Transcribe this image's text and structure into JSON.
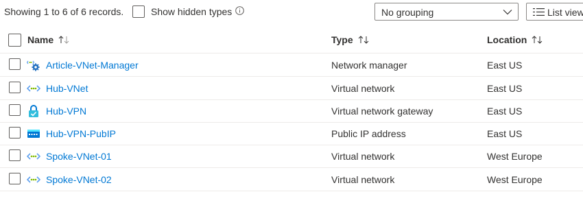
{
  "toolbar": {
    "records_text": "Showing 1 to 6 of 6 records.",
    "show_hidden_label": "Show hidden types",
    "grouping_value": "No grouping",
    "view_label": "List view"
  },
  "columns": {
    "name": "Name",
    "type": "Type",
    "location": "Location"
  },
  "rows": [
    {
      "name": "Article-VNet-Manager",
      "type": "Network manager",
      "location": "East US",
      "icon": "network-manager-icon"
    },
    {
      "name": "Hub-VNet",
      "type": "Virtual network",
      "location": "East US",
      "icon": "virtual-network-icon"
    },
    {
      "name": "Hub-VPN",
      "type": "Virtual network gateway",
      "location": "East US",
      "icon": "vpn-gateway-icon"
    },
    {
      "name": "Hub-VPN-PubIP",
      "type": "Public IP address",
      "location": "East US",
      "icon": "public-ip-icon"
    },
    {
      "name": "Spoke-VNet-01",
      "type": "Virtual network",
      "location": "West Europe",
      "icon": "virtual-network-icon"
    },
    {
      "name": "Spoke-VNet-02",
      "type": "Virtual network",
      "location": "West Europe",
      "icon": "virtual-network-icon"
    }
  ],
  "colors": {
    "link": "#0078d4",
    "text": "#323130",
    "border": "#edebe9",
    "vnet_green": "#5ea0ef"
  }
}
